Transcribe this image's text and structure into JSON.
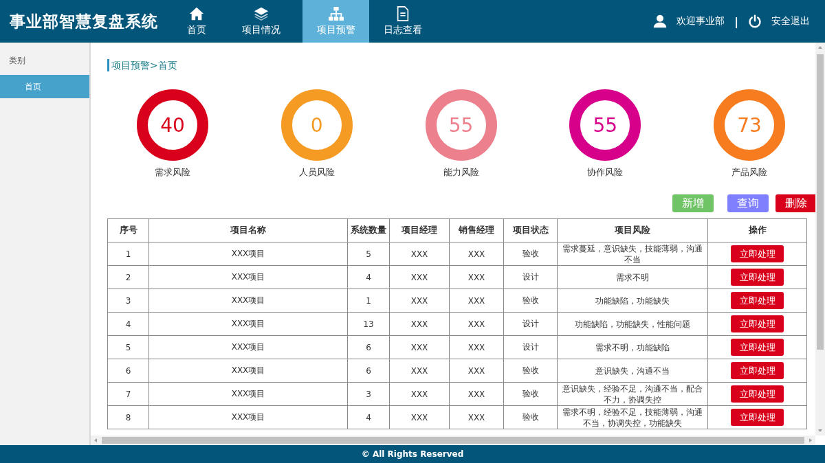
{
  "app_title": "事业部智慧复盘系统",
  "nav": [
    {
      "label": "首页",
      "kind": "home",
      "selected": false
    },
    {
      "label": "项目情况",
      "kind": "layers",
      "selected": false
    },
    {
      "label": "项目预警",
      "kind": "sitemap",
      "selected": true
    },
    {
      "label": "日志查看",
      "kind": "document",
      "selected": false
    }
  ],
  "user": {
    "welcome": "欢迎事业部",
    "separator": "|",
    "logout": "安全退出"
  },
  "sidebar": {
    "heading": "类别",
    "items": [
      {
        "label": "首页",
        "selected": true
      }
    ]
  },
  "breadcrumb": "项目预警>首页",
  "gauges": [
    {
      "value": "40",
      "label": "需求风险",
      "color": "#d9001b"
    },
    {
      "value": "0",
      "label": "人员风险",
      "color": "#f59a23"
    },
    {
      "value": "55",
      "label": "能力风险",
      "color": "#ec808d"
    },
    {
      "value": "55",
      "label": "协作风险",
      "color": "#d6008a"
    },
    {
      "value": "73",
      "label": "产品风险",
      "color": "#f77c1f"
    }
  ],
  "actions": [
    {
      "label": "新增",
      "color": "#70c466"
    },
    {
      "label": "查询",
      "color": "#8080ff"
    },
    {
      "label": "删除",
      "color": "#d9001b"
    }
  ],
  "table": {
    "columns": [
      "序号",
      "项目名称",
      "系统数量",
      "项目经理",
      "销售经理",
      "项目状态",
      "项目风险",
      "操作"
    ],
    "rows": [
      {
        "no": "1",
        "name": "XXX项目",
        "systems": "5",
        "pm": "XXX",
        "sales": "XXX",
        "status": "验收",
        "risk": "需求蔓延，意识缺失，技能薄弱，沟通不当",
        "action": "立即处理"
      },
      {
        "no": "2",
        "name": "XXX项目",
        "systems": "4",
        "pm": "XXX",
        "sales": "XXX",
        "status": "设计",
        "risk": "需求不明",
        "action": "立即处理"
      },
      {
        "no": "3",
        "name": "XXX项目",
        "systems": "1",
        "pm": "XXX",
        "sales": "XXX",
        "status": "验收",
        "risk": "功能缺陷，功能缺失",
        "action": "立即处理"
      },
      {
        "no": "4",
        "name": "XXX项目",
        "systems": "13",
        "pm": "XXX",
        "sales": "XXX",
        "status": "设计",
        "risk": "功能缺陷，功能缺失，性能问题",
        "action": "立即处理"
      },
      {
        "no": "5",
        "name": "XXX项目",
        "systems": "6",
        "pm": "XXX",
        "sales": "XXX",
        "status": "设计",
        "risk": "需求不明，功能缺陷",
        "action": "立即处理"
      },
      {
        "no": "6",
        "name": "XXX项目",
        "systems": "6",
        "pm": "XXX",
        "sales": "XXX",
        "status": "验收",
        "risk": "意识缺失，沟通不当",
        "action": "立即处理"
      },
      {
        "no": "7",
        "name": "XXX项目",
        "systems": "3",
        "pm": "XXX",
        "sales": "XXX",
        "status": "验收",
        "risk": "意识缺失，经验不足，沟通不当，配合不力，协调失控",
        "action": "立即处理"
      },
      {
        "no": "8",
        "name": "XXX项目",
        "systems": "4",
        "pm": "XXX",
        "sales": "XXX",
        "status": "验收",
        "risk": "需求不明，经验不足，技能薄弱，沟通不当，协调失控，功能缺失",
        "action": "立即处理"
      }
    ]
  },
  "footer": "© All Rights Reserved"
}
